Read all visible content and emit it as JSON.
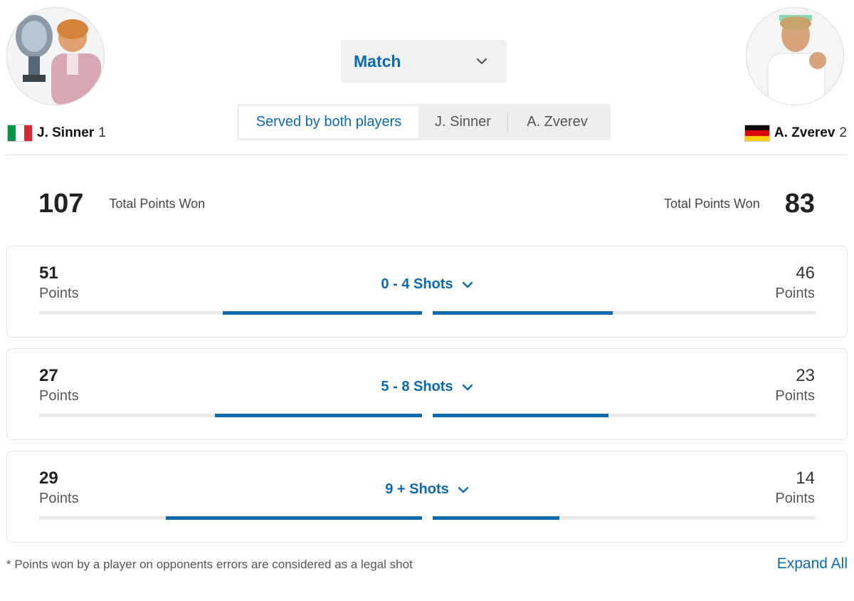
{
  "players": {
    "left": {
      "name": "J. Sinner",
      "seed": "1",
      "country": "italy"
    },
    "right": {
      "name": "A. Zverev",
      "seed": "2",
      "country": "germany"
    }
  },
  "period_dropdown": {
    "selected": "Match"
  },
  "server_filter": {
    "tabs": [
      "Served by both players",
      "J. Sinner",
      "A. Zverev"
    ],
    "active_index": 0
  },
  "totals": {
    "label": "Total Points Won",
    "left_value": "107",
    "right_value": "83"
  },
  "rallies": [
    {
      "range": "0 - 4 Shots",
      "left_points": "51",
      "right_points": "46",
      "unit": "Points",
      "left_fraction": 0.52,
      "right_fraction": 0.47
    },
    {
      "range": "5 - 8 Shots",
      "left_points": "27",
      "right_points": "23",
      "unit": "Points",
      "left_fraction": 0.54,
      "right_fraction": 0.46
    },
    {
      "range": "9 + Shots",
      "left_points": "29",
      "right_points": "14",
      "unit": "Points",
      "left_fraction": 0.67,
      "right_fraction": 0.33
    }
  ],
  "footer": {
    "note": "* Points won by a player on opponents errors are considered as a legal shot",
    "expand_all": "Expand All"
  },
  "colors": {
    "accent": "#0a6ab1",
    "track": "#e8e8e8"
  }
}
